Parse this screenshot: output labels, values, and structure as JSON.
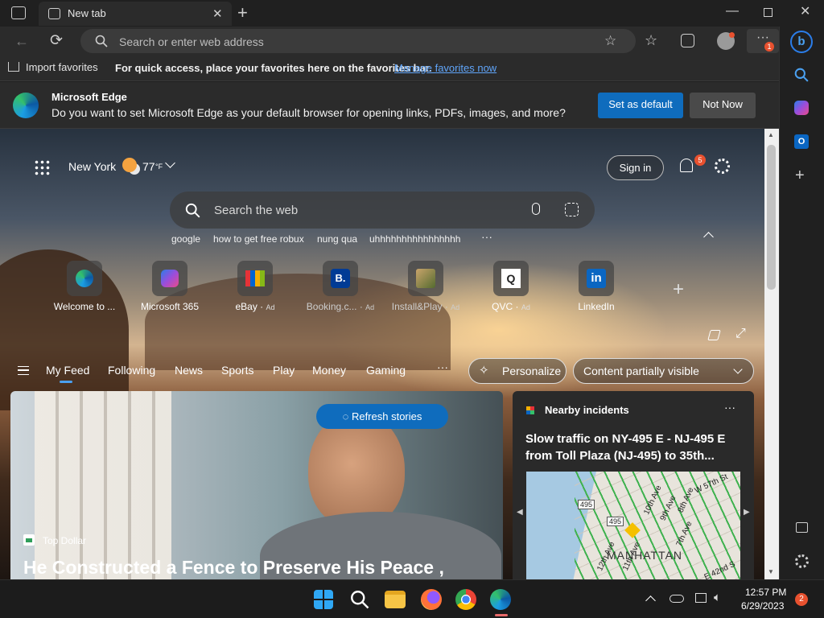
{
  "browser": {
    "tab_title": "New tab",
    "address_placeholder": "Search or enter web address",
    "extensions_badge": "1"
  },
  "favorites_bar": {
    "import_label": "Import favorites",
    "hint": "For quick access, place your favorites here on the favorites bar.",
    "manage_link": "Manage favorites now"
  },
  "infobar": {
    "title": "Microsoft Edge",
    "message": "Do you want to set Microsoft Edge as your default browser for opening links, PDFs, images, and more?",
    "primary_button": "Set as default",
    "secondary_button": "Not Now"
  },
  "newtab": {
    "location": "New York",
    "temperature": "77",
    "temp_unit": "°F",
    "sign_in": "Sign in",
    "notification_count": "5",
    "search_placeholder": "Search the web",
    "trending": [
      "google",
      "how to get free robux",
      "nung qua",
      "uhhhhhhhhhhhhhhhh"
    ],
    "quick_links": [
      {
        "label": "Welcome to ...",
        "ad": ""
      },
      {
        "label": "Microsoft 365",
        "ad": ""
      },
      {
        "label": "eBay",
        "ad": "Ad"
      },
      {
        "label": "Booking.c...",
        "ad": "Ad"
      },
      {
        "label": "Install&Play",
        "ad": "Ad"
      },
      {
        "label": "QVC",
        "ad": "Ad"
      },
      {
        "label": "LinkedIn",
        "ad": ""
      }
    ],
    "feed_tabs": [
      "My Feed",
      "Following",
      "News",
      "Sports",
      "Play",
      "Money",
      "Gaming"
    ],
    "personalize": "Personalize",
    "content_visibility": "Content partially visible",
    "refresh_stories": "Refresh stories",
    "hero": {
      "source": "Top Dollar",
      "headline": "He Constructed a Fence to Preserve His Peace ,"
    },
    "side_card": {
      "title": "Nearby incidents",
      "headline": "Slow traffic on NY-495 E - NJ-495 E from Toll Plaza (NJ-495) to 35th...",
      "map_label": "MANHATTAN",
      "road_shield_1": "495",
      "road_shield_2": "495",
      "streets": [
        "9th Ave",
        "10th Ave",
        "8th Ave",
        "W 57th St",
        "7th Ave",
        "12th Ave",
        "11th Ave",
        "E 42nd S"
      ]
    }
  },
  "taskbar": {
    "time": "12:57 PM",
    "date": "6/29/2023",
    "notifications": "2"
  },
  "colors": {
    "accent": "#0f6cbd",
    "link": "#60a5fa",
    "badge": "#e8512f"
  }
}
